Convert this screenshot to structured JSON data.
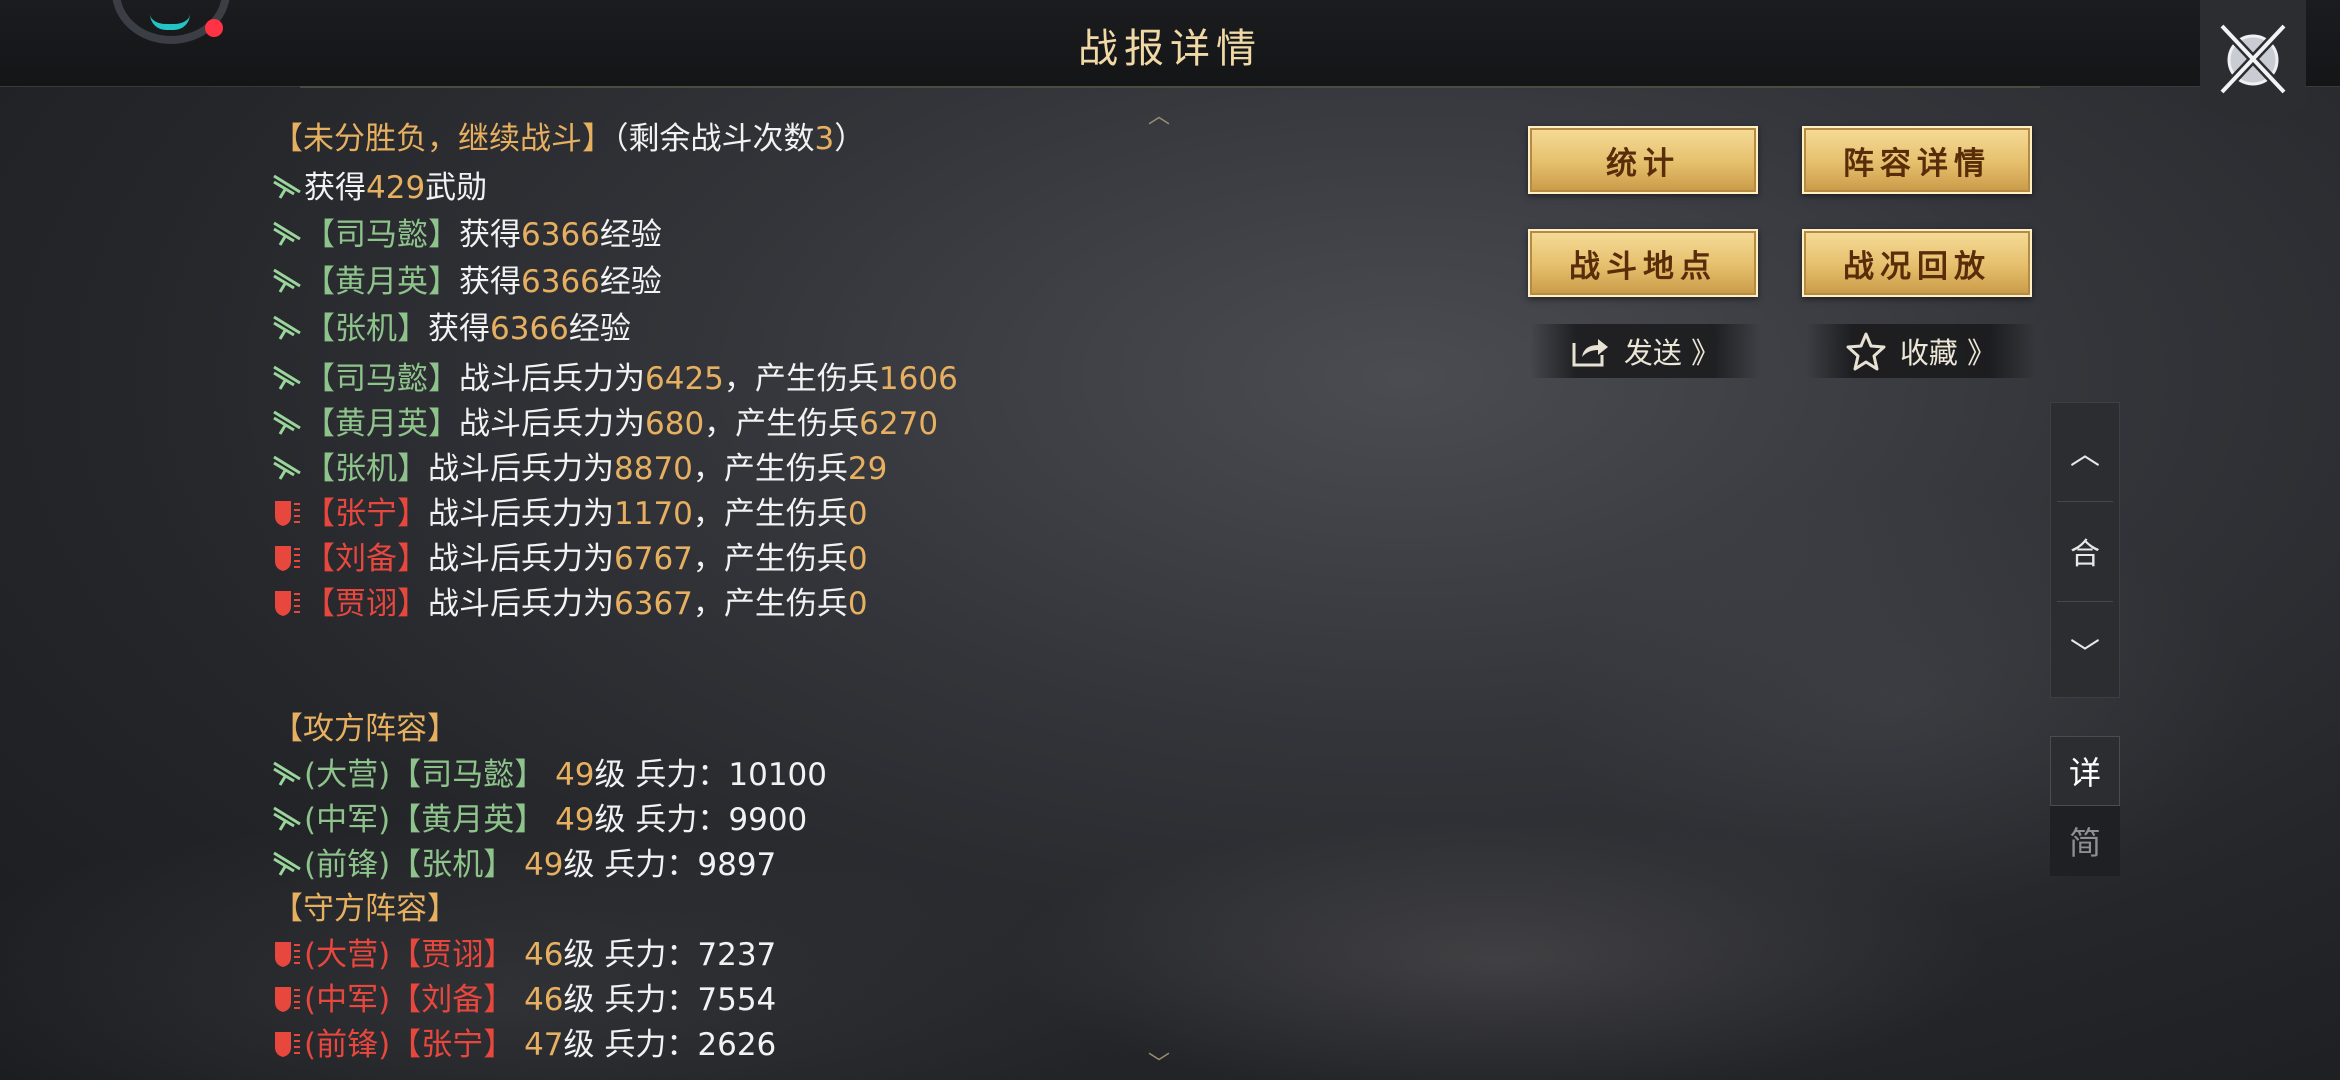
{
  "header": {
    "title": "战报详情"
  },
  "result": {
    "status": "【未分胜负，继续战斗】",
    "remaining_prefix": "（剩余战斗次数",
    "remaining_count": "3",
    "remaining_suffix": "）"
  },
  "merit": {
    "prefix": "获得",
    "value": "429",
    "suffix": "武勋"
  },
  "exp_lines": [
    {
      "name": "【司马懿】",
      "prefix": "获得",
      "value": "6366",
      "suffix": "经验"
    },
    {
      "name": "【黄月英】",
      "prefix": "获得",
      "value": "6366",
      "suffix": "经验"
    },
    {
      "name": "【张机】",
      "prefix": "获得",
      "value": "6366",
      "suffix": "经验"
    }
  ],
  "troop_lines": [
    {
      "side": "attack",
      "name": "【司马懿】",
      "label1": "战斗后兵力为",
      "troops": "6425",
      "label2": "，产生伤兵",
      "wounded": "1606"
    },
    {
      "side": "attack",
      "name": "【黄月英】",
      "label1": "战斗后兵力为",
      "troops": "680",
      "label2": "，产生伤兵",
      "wounded": "6270"
    },
    {
      "side": "attack",
      "name": "【张机】",
      "label1": "战斗后兵力为",
      "troops": "8870",
      "label2": "，产生伤兵",
      "wounded": "29"
    },
    {
      "side": "defend",
      "name": "【张宁】",
      "label1": "战斗后兵力为",
      "troops": "1170",
      "label2": "，产生伤兵",
      "wounded": "0"
    },
    {
      "side": "defend",
      "name": "【刘备】",
      "label1": "战斗后兵力为",
      "troops": "6767",
      "label2": "，产生伤兵",
      "wounded": "0"
    },
    {
      "side": "defend",
      "name": "【贾诩】",
      "label1": "战斗后兵力为",
      "troops": "6367",
      "label2": "，产生伤兵",
      "wounded": "0"
    }
  ],
  "attacker": {
    "heading": "【攻方阵容】",
    "members": [
      {
        "pos": "(大营)",
        "name": "【司马懿】",
        "level": "49",
        "level_label": "级 兵力：",
        "troops": "10100"
      },
      {
        "pos": "(中军)",
        "name": "【黄月英】",
        "level": "49",
        "level_label": "级 兵力：",
        "troops": "9900"
      },
      {
        "pos": "(前锋)",
        "name": "【张机】",
        "level": "49",
        "level_label": "级 兵力：",
        "troops": "9897"
      }
    ]
  },
  "defender": {
    "heading": "【守方阵容】",
    "members": [
      {
        "pos": "(大营)",
        "name": "【贾诩】",
        "level": "46",
        "level_label": "级 兵力：",
        "troops": "7237"
      },
      {
        "pos": "(中军)",
        "name": "【刘备】",
        "level": "46",
        "level_label": "级 兵力：",
        "troops": "7554"
      },
      {
        "pos": "(前锋)",
        "name": "【张宁】",
        "level": "47",
        "level_label": "级 兵力：",
        "troops": "2626"
      }
    ]
  },
  "buttons": {
    "stats": "统计",
    "lineup": "阵容详情",
    "location": "战斗地点",
    "replay": "战况回放",
    "send": "发送 》",
    "favorite": "收藏 》"
  },
  "side_panel": {
    "up": "︿",
    "merge": "合",
    "down": "﹀",
    "detail": "详",
    "simple": "简"
  },
  "icons": [
    "sword-icon",
    "shield-icon",
    "share-icon",
    "star-icon",
    "crossed-swords-icon"
  ],
  "colors": {
    "gold": "#e7b060",
    "green": "#8ec48c",
    "red": "#e8473e",
    "title": "#f1d9a6",
    "button": "#e5bf6c"
  }
}
